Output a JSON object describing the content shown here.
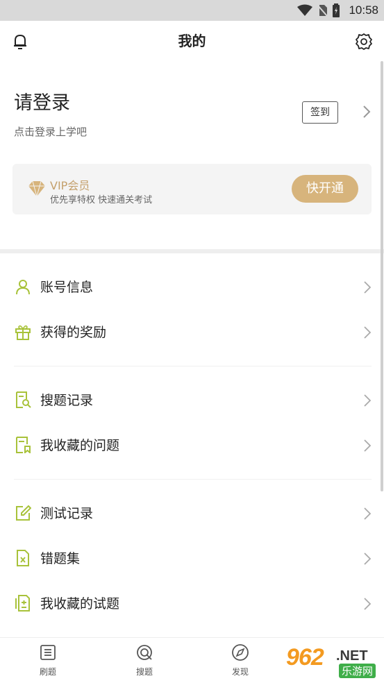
{
  "status_bar": {
    "time": "10:58"
  },
  "header": {
    "title": "我的"
  },
  "login": {
    "title": "请登录",
    "subtitle": "点击登录上学吧",
    "signin_label": "签到"
  },
  "vip": {
    "title": "VIP会员",
    "subtitle": "优先享特权 快速通关考试",
    "button_label": "快开通"
  },
  "menu": {
    "group1": [
      {
        "label": "账号信息",
        "icon": "user-icon"
      },
      {
        "label": "获得的奖励",
        "icon": "gift-icon"
      }
    ],
    "group2": [
      {
        "label": "搜题记录",
        "icon": "search-doc-icon"
      },
      {
        "label": "我收藏的问题",
        "icon": "bookmark-doc-icon"
      }
    ],
    "group3": [
      {
        "label": "测试记录",
        "icon": "edit-icon"
      },
      {
        "label": "错题集",
        "icon": "error-doc-icon"
      },
      {
        "label": "我收藏的试题",
        "icon": "fav-paper-icon"
      }
    ]
  },
  "tabbar": [
    {
      "label": "刷题",
      "icon": "list-icon"
    },
    {
      "label": "搜题",
      "icon": "search-icon"
    },
    {
      "label": "发现",
      "icon": "compass-icon"
    }
  ],
  "watermark": {
    "num": "962",
    "net": ".NET",
    "cn": "乐游网"
  },
  "colors": {
    "accent_icon": "#a8c23a",
    "vip_gold": "#d7b47c",
    "vip_text": "#c4a06c"
  }
}
